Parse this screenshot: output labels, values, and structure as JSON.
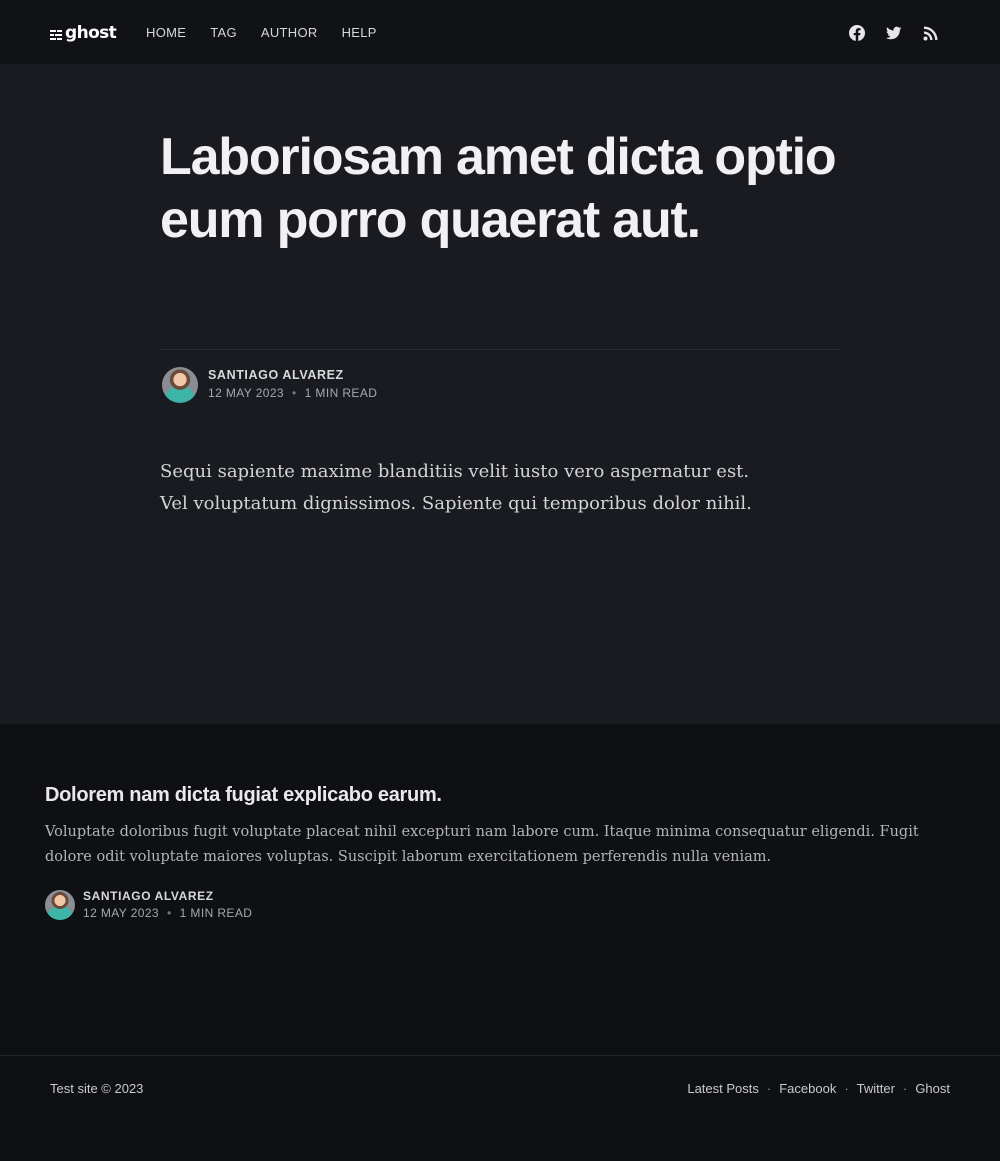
{
  "header": {
    "logo_text": "ghost",
    "nav": [
      {
        "label": "HOME"
      },
      {
        "label": "TAG"
      },
      {
        "label": "AUTHOR"
      },
      {
        "label": "HELP"
      }
    ],
    "social": [
      "facebook-icon",
      "twitter-icon",
      "rss-icon"
    ]
  },
  "article": {
    "title": "Laboriosam amet dicta optio eum porro quaerat aut.",
    "author": "SANTIAGO ALVAREZ",
    "date": "12 MAY 2023",
    "reading_time": "1 MIN READ",
    "excerpt": "Sequi sapiente maxime blanditiis velit iusto vero aspernatur est. Vel voluptatum dignissimos. Sapiente qui temporibus dolor nihil."
  },
  "related": {
    "title": "Dolorem nam dicta fugiat explicabo earum.",
    "excerpt": "Voluptate doloribus fugit voluptate placeat nihil excepturi nam labore cum. Itaque minima consequatur eligendi. Fugit dolore odit voluptate maiores voluptas. Suscipit laborum exercitationem perferendis nulla veniam.",
    "author": "SANTIAGO ALVAREZ",
    "date": "12 MAY 2023",
    "reading_time": "1 MIN READ"
  },
  "footer": {
    "copyright": "Test site © 2023",
    "links": [
      {
        "label": "Latest Posts"
      },
      {
        "label": "Facebook"
      },
      {
        "label": "Twitter"
      },
      {
        "label": "Ghost"
      }
    ],
    "separator": "·"
  },
  "meta_separator": "•",
  "colors": {
    "header_bg": "#111215",
    "article_bg": "#1a1b20",
    "page_bg": "#0f1014",
    "text": "#e8e8ea"
  }
}
